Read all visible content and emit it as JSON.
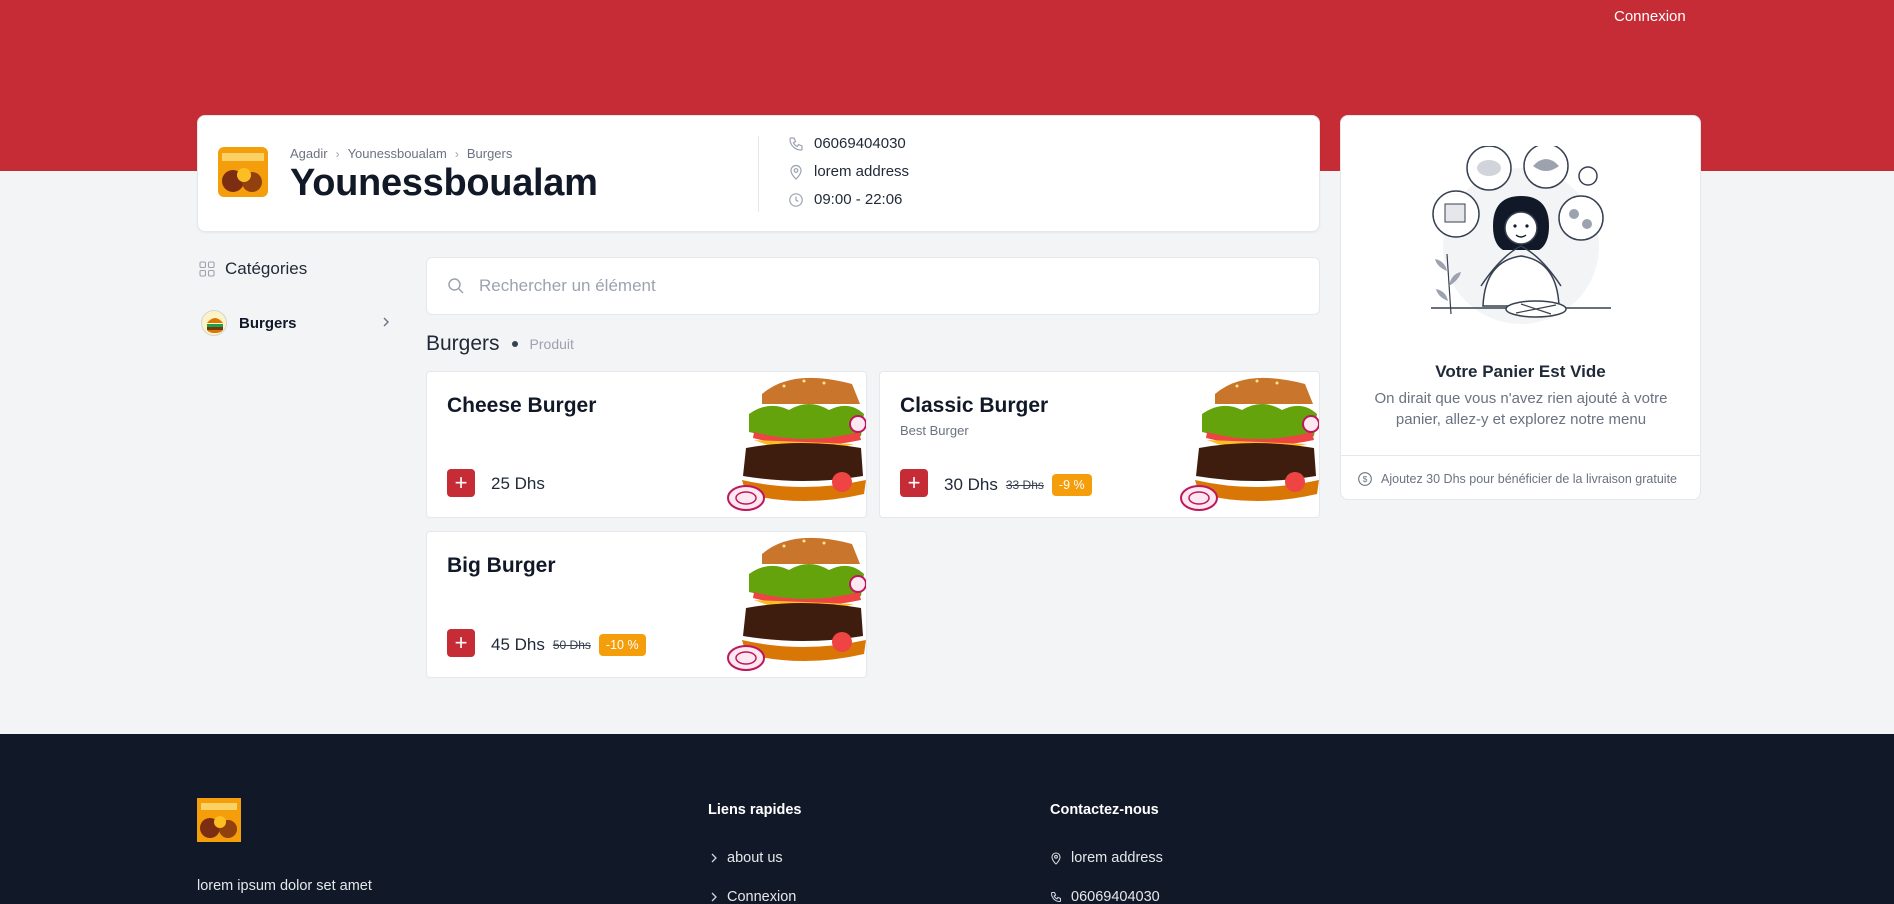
{
  "header": {
    "login_label": "Connexion"
  },
  "store": {
    "breadcrumb": [
      "Agadir",
      "Younessboualam",
      "Burgers"
    ],
    "name": "Younessboualam",
    "phone": "06069404030",
    "address": "lorem address",
    "hours": "09:00 - 22:06"
  },
  "cart": {
    "title": "Votre Panier Est Vide",
    "text": "On dirait que vous n'avez rien ajouté à votre panier, allez-y et explorez notre menu",
    "footer_note": "Ajoutez 30 Dhs pour bénéficier de la livraison gratuite"
  },
  "sidebar": {
    "title": "Catégories",
    "items": [
      {
        "label": "Burgers"
      }
    ]
  },
  "search": {
    "placeholder": "Rechercher un élément"
  },
  "section": {
    "title": "Burgers",
    "subtitle": "Produit"
  },
  "products": [
    {
      "name": "Cheese Burger",
      "description": "",
      "price": "25 Dhs",
      "old_price": "",
      "discount": ""
    },
    {
      "name": "Classic Burger",
      "description": "Best Burger",
      "price": "30 Dhs",
      "old_price": "33 Dhs",
      "discount": "-9 %"
    },
    {
      "name": "Big Burger",
      "description": "",
      "price": "45 Dhs",
      "old_price": "50 Dhs",
      "discount": "-10 %"
    }
  ],
  "footer": {
    "about": "lorem ipsum dolor set amet",
    "quick_links_title": "Liens rapides",
    "quick_links": [
      "about us",
      "Connexion"
    ],
    "contact_title": "Contactez-nous",
    "contact": {
      "address": "lorem address",
      "phone": "06069404030"
    }
  },
  "colors": {
    "brand": "#c52c36",
    "badge": "#f59e0b",
    "footer_bg": "#111827"
  }
}
